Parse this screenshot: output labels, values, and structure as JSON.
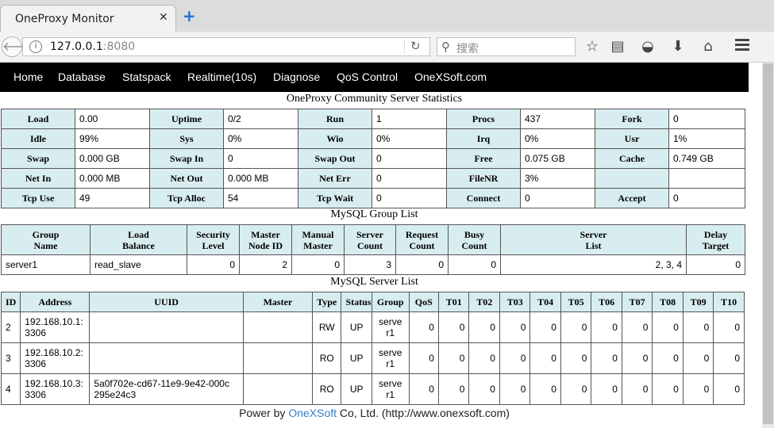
{
  "browser": {
    "tab_title": "OneProxy Monitor",
    "url_host": "127.0.0.1",
    "url_port": ":8080",
    "search_placeholder": "搜索"
  },
  "nav": [
    "Home",
    "Database",
    "Statspack",
    "Realtime(10s)",
    "Diagnose",
    "QoS Control",
    "OneXSoft.com"
  ],
  "stats": {
    "title": "OneProxy Community Server Statistics",
    "rows": [
      [
        [
          "Load",
          "0.00"
        ],
        [
          "Uptime",
          "0/2"
        ],
        [
          "Run",
          "1"
        ],
        [
          "Procs",
          "437"
        ],
        [
          "Fork",
          "0"
        ]
      ],
      [
        [
          "Idle",
          "99%"
        ],
        [
          "Sys",
          "0%"
        ],
        [
          "Wio",
          "0%"
        ],
        [
          "Irq",
          "0%"
        ],
        [
          "Usr",
          "1%"
        ]
      ],
      [
        [
          "Swap",
          "0.000 GB"
        ],
        [
          "Swap In",
          "0"
        ],
        [
          "Swap Out",
          "0"
        ],
        [
          "Free",
          "0.075 GB"
        ],
        [
          "Cache",
          "0.749 GB"
        ]
      ],
      [
        [
          "Net In",
          "0.000 MB"
        ],
        [
          "Net Out",
          "0.000 MB"
        ],
        [
          "Net Err",
          "0"
        ],
        [
          "FileNR",
          "3%"
        ],
        [
          "",
          ""
        ]
      ],
      [
        [
          "Tcp Use",
          "49"
        ],
        [
          "Tcp Alloc",
          "54"
        ],
        [
          "Tcp Wait",
          "0"
        ],
        [
          "Connect",
          "0"
        ],
        [
          "Accept",
          "0"
        ]
      ]
    ]
  },
  "groups": {
    "title": "MySQL Group List",
    "headers": [
      [
        "Group",
        "Name"
      ],
      [
        "Load",
        "Balance"
      ],
      [
        "Security",
        "Level"
      ],
      [
        "Master",
        "Node ID"
      ],
      [
        "Manual",
        "Master"
      ],
      [
        "Server",
        "Count"
      ],
      [
        "Request",
        "Count"
      ],
      [
        "Busy",
        "Count"
      ],
      [
        "Server",
        "List"
      ],
      [
        "Delay",
        "Target"
      ]
    ],
    "rows": [
      [
        "server1",
        "read_slave",
        "0",
        "2",
        "0",
        "3",
        "0",
        "0",
        "2, 3, 4",
        "0"
      ]
    ]
  },
  "servers": {
    "title": "MySQL Server List",
    "headers": [
      "ID",
      "Address",
      "UUID",
      "Master",
      "Type",
      "Status",
      "Group",
      "QoS",
      "T01",
      "T02",
      "T03",
      "T04",
      "T05",
      "T06",
      "T07",
      "T08",
      "T09",
      "T10"
    ],
    "rows": [
      [
        "2",
        "192.168.10.1:\n3306",
        "",
        "",
        "RW",
        "UP",
        "serve\nr1",
        "0",
        "0",
        "0",
        "0",
        "0",
        "0",
        "0",
        "0",
        "0",
        "0",
        "0"
      ],
      [
        "3",
        "192.168.10.2:\n3306",
        "",
        "",
        "RO",
        "UP",
        "serve\nr1",
        "0",
        "0",
        "0",
        "0",
        "0",
        "0",
        "0",
        "0",
        "0",
        "0",
        "0"
      ],
      [
        "4",
        "192.168.10.3:\n3306",
        "5a0f702e-cd67-11e9-9e42-000c\n295e24c3",
        "",
        "RO",
        "UP",
        "serve\nr1",
        "0",
        "0",
        "0",
        "0",
        "0",
        "0",
        "0",
        "0",
        "0",
        "0",
        "0"
      ]
    ]
  },
  "footer": {
    "prefix": "Power by ",
    "link": "OneXSoft",
    "suffix": " Co, Ltd. (http://www.onexsoft.com)"
  }
}
